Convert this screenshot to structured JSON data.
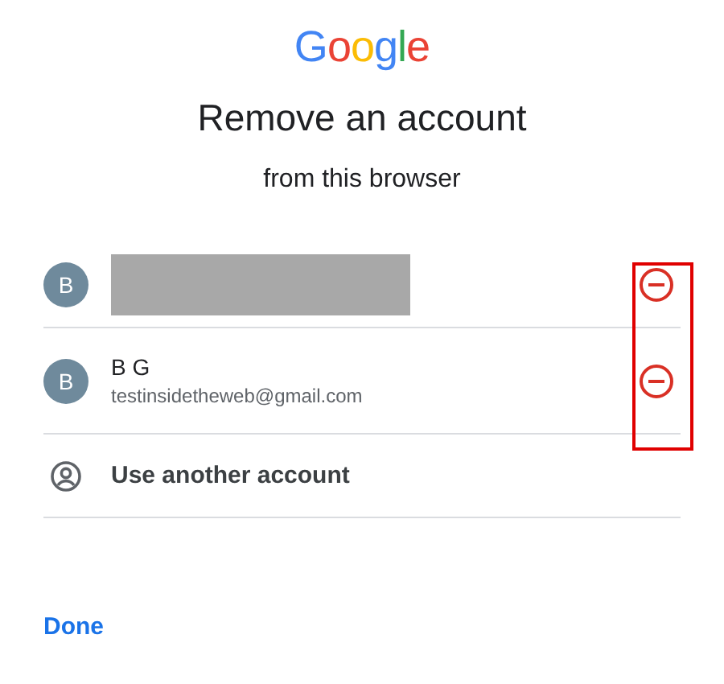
{
  "logo": "Google",
  "title": "Remove an account",
  "subtitle": "from this browser",
  "accounts": [
    {
      "kind": "redacted",
      "initial": "B"
    },
    {
      "kind": "named",
      "initial": "B",
      "name": "B G",
      "email": "testinsidetheweb@gmail.com"
    }
  ],
  "other_account": "Use another account",
  "done": "Done"
}
